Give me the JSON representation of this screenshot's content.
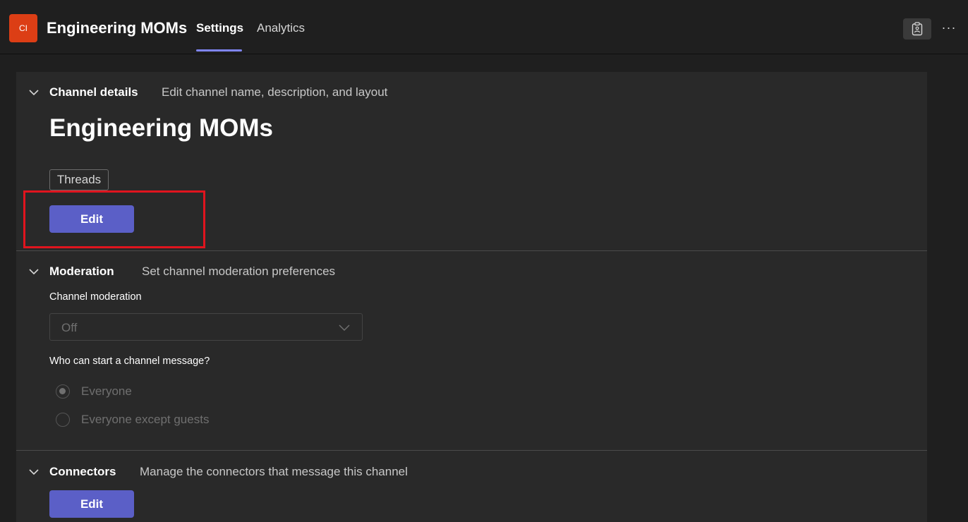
{
  "header": {
    "team_initials": "CI",
    "channel_name": "Engineering MOMs",
    "tabs": [
      {
        "label": "Settings",
        "active": true
      },
      {
        "label": "Analytics",
        "active": false
      }
    ],
    "more_label": "···"
  },
  "colors": {
    "accent": "#5b5fc7",
    "team_avatar": "#dc3e15",
    "highlight": "#e0141e"
  },
  "channel_details": {
    "title": "Channel details",
    "description": "Edit channel name, description, and layout",
    "channel_name": "Engineering MOMs",
    "layout_chip": "Threads",
    "edit_label": "Edit"
  },
  "moderation": {
    "title": "Moderation",
    "description": "Set channel moderation preferences",
    "channel_moderation_label": "Channel moderation",
    "channel_moderation_value": "Off",
    "who_can_start_label": "Who can start a channel message?",
    "options": [
      {
        "label": "Everyone",
        "checked": true
      },
      {
        "label": "Everyone except guests",
        "checked": false
      }
    ]
  },
  "connectors": {
    "title": "Connectors",
    "description": "Manage the connectors that message this channel",
    "edit_label": "Edit"
  }
}
